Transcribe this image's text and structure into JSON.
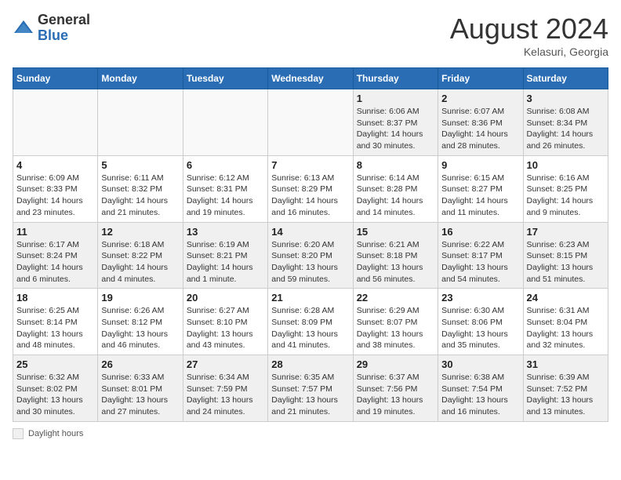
{
  "header": {
    "logo": {
      "general": "General",
      "blue": "Blue"
    },
    "title": "August 2024",
    "location": "Kelasuri, Georgia"
  },
  "days_of_week": [
    "Sunday",
    "Monday",
    "Tuesday",
    "Wednesday",
    "Thursday",
    "Friday",
    "Saturday"
  ],
  "weeks": [
    [
      {
        "day": "",
        "info": ""
      },
      {
        "day": "",
        "info": ""
      },
      {
        "day": "",
        "info": ""
      },
      {
        "day": "",
        "info": ""
      },
      {
        "day": "1",
        "info": "Sunrise: 6:06 AM\nSunset: 8:37 PM\nDaylight: 14 hours and 30 minutes."
      },
      {
        "day": "2",
        "info": "Sunrise: 6:07 AM\nSunset: 8:36 PM\nDaylight: 14 hours and 28 minutes."
      },
      {
        "day": "3",
        "info": "Sunrise: 6:08 AM\nSunset: 8:34 PM\nDaylight: 14 hours and 26 minutes."
      }
    ],
    [
      {
        "day": "4",
        "info": "Sunrise: 6:09 AM\nSunset: 8:33 PM\nDaylight: 14 hours and 23 minutes."
      },
      {
        "day": "5",
        "info": "Sunrise: 6:11 AM\nSunset: 8:32 PM\nDaylight: 14 hours and 21 minutes."
      },
      {
        "day": "6",
        "info": "Sunrise: 6:12 AM\nSunset: 8:31 PM\nDaylight: 14 hours and 19 minutes."
      },
      {
        "day": "7",
        "info": "Sunrise: 6:13 AM\nSunset: 8:29 PM\nDaylight: 14 hours and 16 minutes."
      },
      {
        "day": "8",
        "info": "Sunrise: 6:14 AM\nSunset: 8:28 PM\nDaylight: 14 hours and 14 minutes."
      },
      {
        "day": "9",
        "info": "Sunrise: 6:15 AM\nSunset: 8:27 PM\nDaylight: 14 hours and 11 minutes."
      },
      {
        "day": "10",
        "info": "Sunrise: 6:16 AM\nSunset: 8:25 PM\nDaylight: 14 hours and 9 minutes."
      }
    ],
    [
      {
        "day": "11",
        "info": "Sunrise: 6:17 AM\nSunset: 8:24 PM\nDaylight: 14 hours and 6 minutes."
      },
      {
        "day": "12",
        "info": "Sunrise: 6:18 AM\nSunset: 8:22 PM\nDaylight: 14 hours and 4 minutes."
      },
      {
        "day": "13",
        "info": "Sunrise: 6:19 AM\nSunset: 8:21 PM\nDaylight: 14 hours and 1 minute."
      },
      {
        "day": "14",
        "info": "Sunrise: 6:20 AM\nSunset: 8:20 PM\nDaylight: 13 hours and 59 minutes."
      },
      {
        "day": "15",
        "info": "Sunrise: 6:21 AM\nSunset: 8:18 PM\nDaylight: 13 hours and 56 minutes."
      },
      {
        "day": "16",
        "info": "Sunrise: 6:22 AM\nSunset: 8:17 PM\nDaylight: 13 hours and 54 minutes."
      },
      {
        "day": "17",
        "info": "Sunrise: 6:23 AM\nSunset: 8:15 PM\nDaylight: 13 hours and 51 minutes."
      }
    ],
    [
      {
        "day": "18",
        "info": "Sunrise: 6:25 AM\nSunset: 8:14 PM\nDaylight: 13 hours and 48 minutes."
      },
      {
        "day": "19",
        "info": "Sunrise: 6:26 AM\nSunset: 8:12 PM\nDaylight: 13 hours and 46 minutes."
      },
      {
        "day": "20",
        "info": "Sunrise: 6:27 AM\nSunset: 8:10 PM\nDaylight: 13 hours and 43 minutes."
      },
      {
        "day": "21",
        "info": "Sunrise: 6:28 AM\nSunset: 8:09 PM\nDaylight: 13 hours and 41 minutes."
      },
      {
        "day": "22",
        "info": "Sunrise: 6:29 AM\nSunset: 8:07 PM\nDaylight: 13 hours and 38 minutes."
      },
      {
        "day": "23",
        "info": "Sunrise: 6:30 AM\nSunset: 8:06 PM\nDaylight: 13 hours and 35 minutes."
      },
      {
        "day": "24",
        "info": "Sunrise: 6:31 AM\nSunset: 8:04 PM\nDaylight: 13 hours and 32 minutes."
      }
    ],
    [
      {
        "day": "25",
        "info": "Sunrise: 6:32 AM\nSunset: 8:02 PM\nDaylight: 13 hours and 30 minutes."
      },
      {
        "day": "26",
        "info": "Sunrise: 6:33 AM\nSunset: 8:01 PM\nDaylight: 13 hours and 27 minutes."
      },
      {
        "day": "27",
        "info": "Sunrise: 6:34 AM\nSunset: 7:59 PM\nDaylight: 13 hours and 24 minutes."
      },
      {
        "day": "28",
        "info": "Sunrise: 6:35 AM\nSunset: 7:57 PM\nDaylight: 13 hours and 21 minutes."
      },
      {
        "day": "29",
        "info": "Sunrise: 6:37 AM\nSunset: 7:56 PM\nDaylight: 13 hours and 19 minutes."
      },
      {
        "day": "30",
        "info": "Sunrise: 6:38 AM\nSunset: 7:54 PM\nDaylight: 13 hours and 16 minutes."
      },
      {
        "day": "31",
        "info": "Sunrise: 6:39 AM\nSunset: 7:52 PM\nDaylight: 13 hours and 13 minutes."
      }
    ]
  ],
  "footer": {
    "shaded_label": "Daylight hours"
  }
}
